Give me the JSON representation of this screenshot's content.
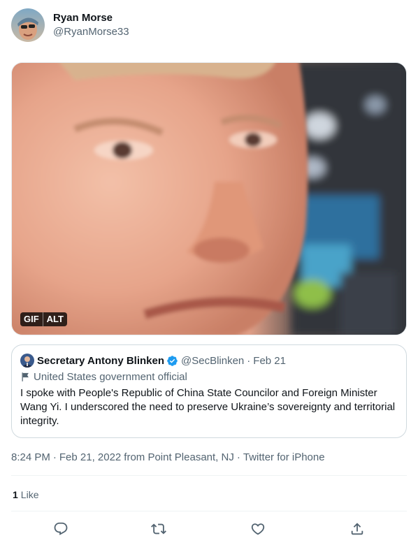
{
  "author": {
    "display_name": "Ryan Morse",
    "handle": "@RyanMorse33"
  },
  "media": {
    "badge_gif": "GIF",
    "badge_alt": "ALT"
  },
  "quoted_tweet": {
    "display_name": "Secretary Antony Blinken",
    "handle": "@SecBlinken",
    "separator": "·",
    "date": "Feb 21",
    "label": "United States government official",
    "text": "I spoke with People's Republic of China State Councilor and Foreign Minister Wang Yi. I underscored the need to preserve Ukraine’s sovereignty and territorial integrity."
  },
  "meta": {
    "time": "8:24 PM",
    "separator": "·",
    "date": "Feb 21, 2022",
    "location": "from Point Pleasant, NJ",
    "source": "Twitter for iPhone"
  },
  "stats": {
    "likes_count": "1",
    "likes_label": "Like"
  },
  "actions": {
    "icons": [
      "reply-icon",
      "retweet-icon",
      "like-icon",
      "share-icon"
    ]
  },
  "colors": {
    "text": "#0f1419",
    "secondary": "#536471",
    "verified_blue": "#1d9bf0",
    "border": "#cfd9de"
  }
}
